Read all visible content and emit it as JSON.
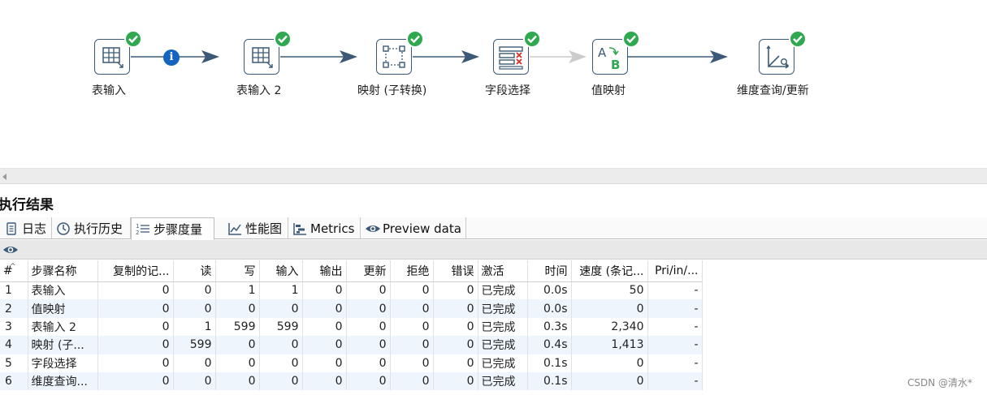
{
  "workflow": {
    "steps": [
      {
        "id": "step1",
        "label": "表输入",
        "icon": "table-input-icon",
        "status": "success"
      },
      {
        "id": "step2",
        "label": "表输入 2",
        "icon": "table-input-icon",
        "status": "success"
      },
      {
        "id": "step3",
        "label": "映射 (子转换)",
        "icon": "mapping-icon",
        "status": "success"
      },
      {
        "id": "step4",
        "label": "字段选择",
        "icon": "select-values-icon",
        "status": "success"
      },
      {
        "id": "step5",
        "label": "值映射",
        "icon": "value-mapper-icon",
        "status": "success"
      },
      {
        "id": "step6",
        "label": "维度查询/更新",
        "icon": "dimension-lookup-icon",
        "status": "success"
      }
    ],
    "hop_info_badge": "i"
  },
  "results": {
    "title": "执行结果",
    "tabs": [
      {
        "label": "日志",
        "icon": "log-icon"
      },
      {
        "label": "执行历史",
        "icon": "history-icon"
      },
      {
        "label": "步骤度量",
        "icon": "step-metrics-icon",
        "active": true
      },
      {
        "label": "性能图",
        "icon": "performance-graph-icon"
      },
      {
        "label": "Metrics",
        "icon": "metrics-icon"
      },
      {
        "label": "Preview data",
        "icon": "preview-eye-icon"
      }
    ],
    "toolbar_icon": "eye-icon",
    "table": {
      "columns": [
        "#",
        "步骤名称",
        "复制的记...",
        "读",
        "写",
        "输入",
        "输出",
        "更新",
        "拒绝",
        "错误",
        "激活",
        "时间",
        "速度 (条记...",
        "Pri/in/..."
      ],
      "rows": [
        [
          "1",
          "表输入",
          "0",
          "0",
          "1",
          "1",
          "0",
          "0",
          "0",
          "0",
          "已完成",
          "0.0s",
          "50",
          "-"
        ],
        [
          "2",
          "值映射",
          "0",
          "0",
          "0",
          "0",
          "0",
          "0",
          "0",
          "0",
          "已完成",
          "0.0s",
          "0",
          "-"
        ],
        [
          "3",
          "表输入 2",
          "0",
          "1",
          "599",
          "599",
          "0",
          "0",
          "0",
          "0",
          "已完成",
          "0.3s",
          "2,340",
          "-"
        ],
        [
          "4",
          "映射 (子...",
          "0",
          "599",
          "0",
          "0",
          "0",
          "0",
          "0",
          "0",
          "已完成",
          "0.4s",
          "1,413",
          "-"
        ],
        [
          "5",
          "字段选择",
          "0",
          "0",
          "0",
          "0",
          "0",
          "0",
          "0",
          "0",
          "已完成",
          "0.1s",
          "0",
          "-"
        ],
        [
          "6",
          "维度查询...",
          "0",
          "0",
          "0",
          "0",
          "0",
          "0",
          "0",
          "0",
          "已完成",
          "0.1s",
          "0",
          "-"
        ]
      ]
    }
  },
  "watermark": "CSDN @清水*",
  "colors": {
    "step_border": "#3c5a78",
    "success_badge": "#2fa84f",
    "hop_arrow": "#3c5a78",
    "hop_disabled": "#cccccc",
    "info_badge": "#1565c0",
    "row_alt": "#eef5fd"
  }
}
